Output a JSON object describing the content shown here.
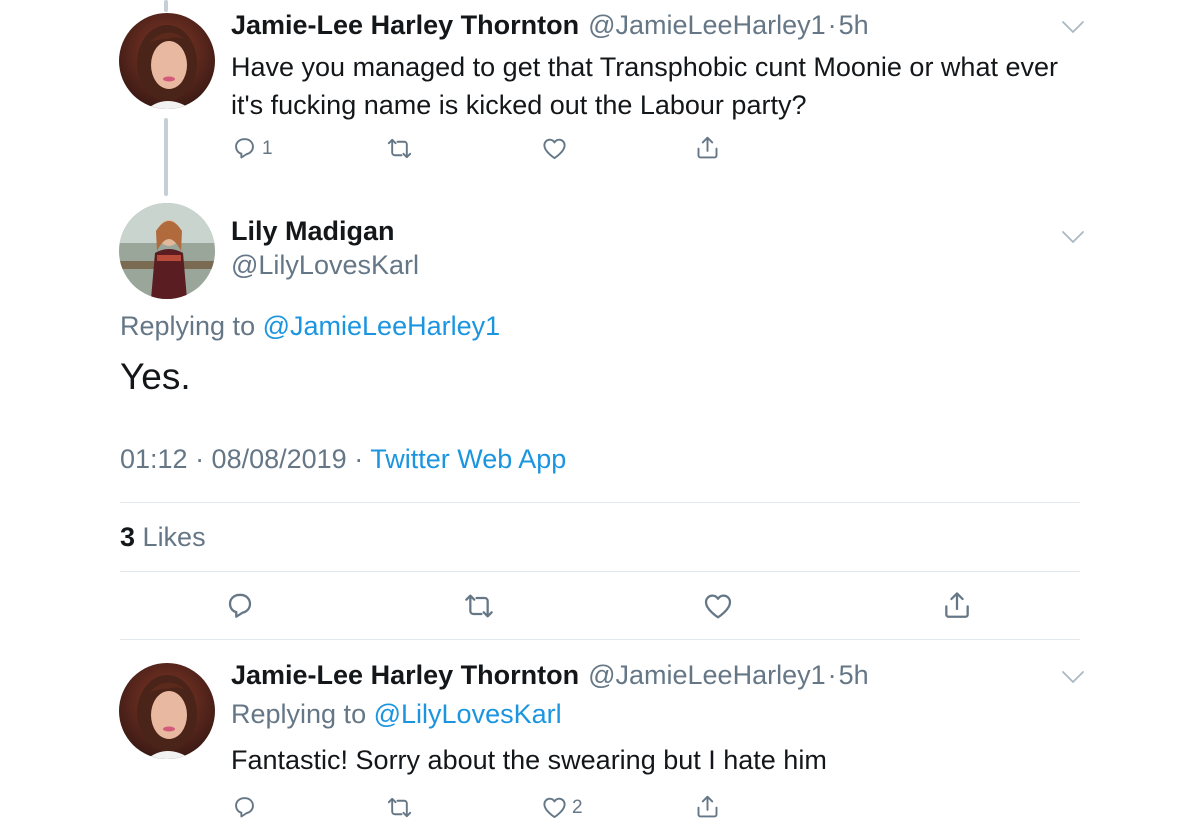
{
  "tweet_parent": {
    "author_name": "Jamie-Lee Harley Thornton",
    "author_handle": "@JamieLeeHarley1",
    "separator": "·",
    "time": "5h",
    "text_line1": "Have you managed to get that Transphobic cunt Moonie or what ever",
    "text_line2": "it's fucking name is kicked out the Labour party?",
    "reply_count": "1",
    "retweet_count": "",
    "like_count": ""
  },
  "tweet_main": {
    "author_name": "Lily Madigan",
    "author_handle": "@LilyLovesKarl",
    "replying_prefix": "Replying to",
    "replying_to": "@JamieLeeHarley1",
    "text": "Yes.",
    "timestamp": "01:12 · 08/08/2019 ·",
    "source": "Twitter Web App",
    "likes_count": "3",
    "likes_label": "Likes"
  },
  "tweet_reply": {
    "author_name": "Jamie-Lee Harley Thornton",
    "author_handle": "@JamieLeeHarley1",
    "separator": "·",
    "time": "5h",
    "replying_prefix": "Replying to",
    "replying_to": "@LilyLovesKarl",
    "text": "Fantastic! Sorry about the swearing but I hate him",
    "reply_count": "",
    "retweet_count": "",
    "like_count": "2"
  },
  "colors": {
    "text": "#14171a",
    "muted": "#657786",
    "link": "#1b95e0",
    "divider": "#e1e8ed",
    "thread_line": "#c4cfd6"
  },
  "icons": [
    "reply-icon",
    "retweet-icon",
    "like-icon",
    "share-icon",
    "chevron-down-icon"
  ]
}
